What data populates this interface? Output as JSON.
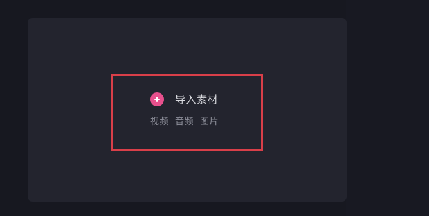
{
  "import": {
    "label": "导入素材",
    "icon": "plus-circle-icon",
    "icon_color": "#e8508d"
  },
  "media_types": [
    "视频",
    "音频",
    "图片"
  ],
  "highlight_color": "#d93f49"
}
